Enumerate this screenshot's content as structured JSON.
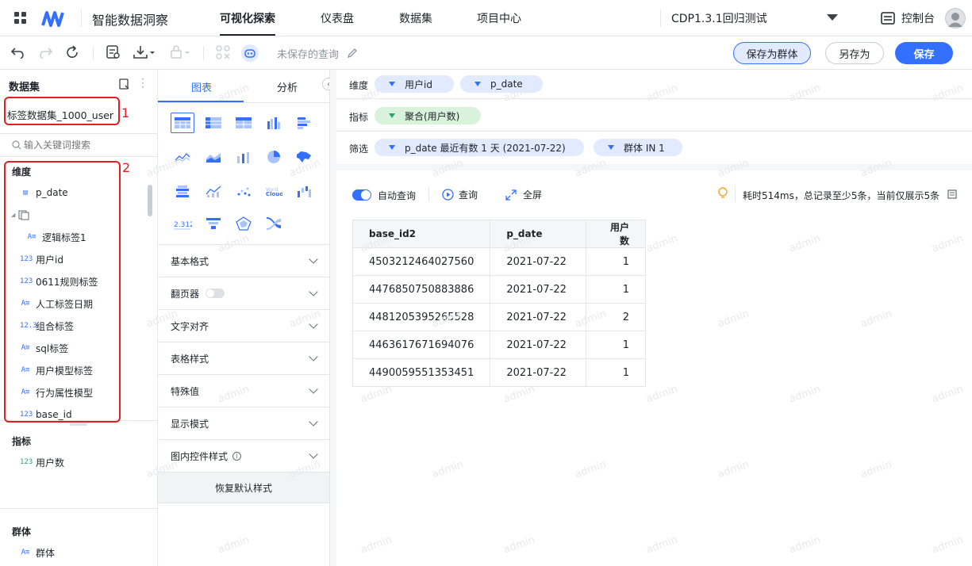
{
  "app": {
    "title": "智能数据洞察",
    "project": "CDP1.3.1回归测试",
    "console": "控制台"
  },
  "nav": {
    "tabs": [
      "可视化探索",
      "仪表盘",
      "数据集",
      "项目中心"
    ]
  },
  "toolbar": {
    "query_name": "未保存的查询",
    "save_group": "保存为群体",
    "save_as": "另存为",
    "save": "保存"
  },
  "dataset": {
    "header": "数据集",
    "name": "标签数据集_1000_user",
    "search_placeholder": "输入关键词搜索"
  },
  "dimensions": {
    "title": "维度",
    "items": [
      {
        "type": "date",
        "label": "p_date"
      },
      {
        "type": "folder",
        "label": ""
      },
      {
        "type": "text",
        "label": "逻辑标签1"
      },
      {
        "type": "num",
        "label": "用户id"
      },
      {
        "type": "num",
        "label": "0611规则标签"
      },
      {
        "type": "text",
        "label": "人工标签日期"
      },
      {
        "type": "float",
        "label": "组合标签"
      },
      {
        "type": "text",
        "label": "sql标签"
      },
      {
        "type": "text",
        "label": "用户模型标签"
      },
      {
        "type": "text",
        "label": "行为属性模型"
      },
      {
        "type": "num",
        "label": "base_id"
      }
    ]
  },
  "metrics": {
    "title": "指标",
    "items": [
      {
        "label": "用户数"
      }
    ]
  },
  "groups": {
    "title": "群体",
    "items": [
      {
        "label": "群体"
      }
    ]
  },
  "annotations": {
    "box1": "1",
    "box2": "2"
  },
  "config": {
    "tabs": [
      "图表",
      "分析"
    ],
    "active_tab": "图表",
    "sections": [
      "基本格式",
      "翻页器",
      "文字对齐",
      "表格样式",
      "特殊值",
      "显示模式",
      "图内控件样式"
    ],
    "reset": "恢复默认样式",
    "gauge_text": "2.312"
  },
  "query": {
    "dim_label": "维度",
    "dims": [
      "用户id",
      "p_date"
    ],
    "metric_label": "指标",
    "metrics": [
      "聚合(用户数)"
    ],
    "filter_label": "筛选",
    "filters": [
      "p_date 最近有数 1 天 (2021-07-22)",
      "群体 IN 1"
    ]
  },
  "result": {
    "auto_query": "自动查询",
    "query": "查询",
    "fullscreen": "全屏",
    "status": "耗时514ms，总记录至少5条，当前仅展示5条",
    "columns": [
      "base_id2",
      "p_date",
      "用户数"
    ],
    "rows": [
      [
        "4503212464027560",
        "2021-07-22",
        "1"
      ],
      [
        "4476850750883886",
        "2021-07-22",
        "1"
      ],
      [
        "4481205395265528",
        "2021-07-22",
        "2"
      ],
      [
        "4463617671694076",
        "2021-07-22",
        "1"
      ],
      [
        "4490059551353451",
        "2021-07-22",
        "1"
      ]
    ]
  },
  "watermark": "admin",
  "colors": {
    "primary": "#3370ff",
    "metric_green": "#d9f2dc",
    "dim_blue": "#e1eaff",
    "annotation_red": "#e02020"
  }
}
